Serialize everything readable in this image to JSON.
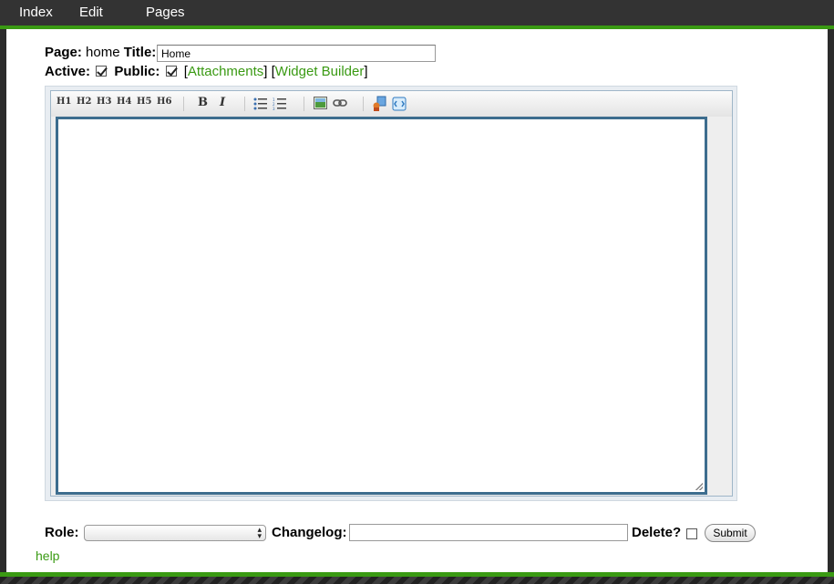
{
  "nav": {
    "items": [
      "Index",
      "Edit",
      "Pages"
    ]
  },
  "page_row": {
    "page_label": "Page:",
    "page_value": "home",
    "title_label": "Title:",
    "title_value": "Home"
  },
  "flags_row": {
    "active_label": "Active:",
    "active_checked": true,
    "public_label": "Public:",
    "public_checked": true,
    "attachments_label": "Attachments",
    "widget_builder_label": "Widget Builder"
  },
  "toolbar": {
    "headings": [
      "H1",
      "H2",
      "H3",
      "H4",
      "H5",
      "H6"
    ],
    "bold": "B",
    "italic": "I"
  },
  "bottom": {
    "role_label": "Role:",
    "changelog_label": "Changelog:",
    "delete_label": "Delete?",
    "submit_label": "Submit",
    "help_label": "help"
  },
  "colors": {
    "accent_green": "#3a9a13",
    "editor_border": "#3d6d8e",
    "topbar": "#333333"
  }
}
